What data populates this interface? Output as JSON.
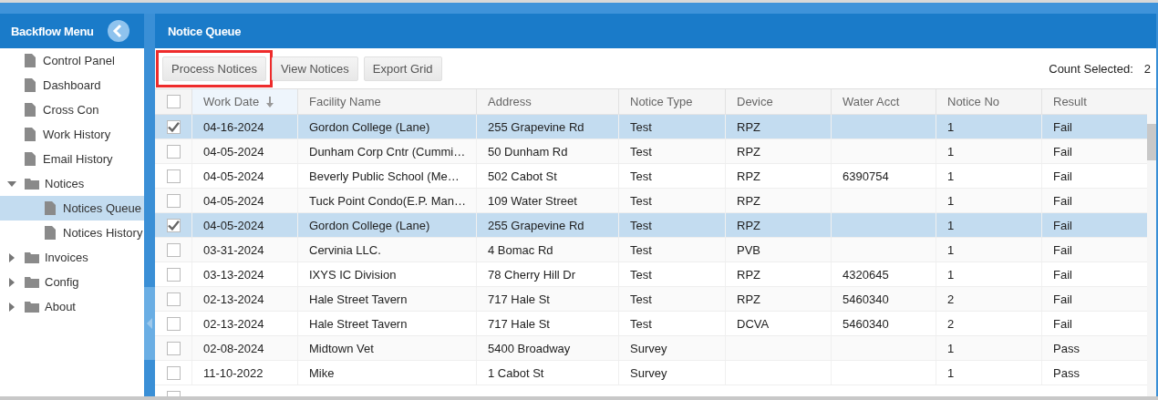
{
  "sidebar": {
    "title": "Backflow Menu",
    "items": [
      {
        "label": "Control Panel",
        "kind": "page",
        "selected": false
      },
      {
        "label": "Dashboard",
        "kind": "page",
        "selected": false
      },
      {
        "label": "Cross Con",
        "kind": "page",
        "selected": false
      },
      {
        "label": "Work History",
        "kind": "page",
        "selected": false
      },
      {
        "label": "Email History",
        "kind": "page",
        "selected": false
      },
      {
        "label": "Notices",
        "kind": "folder",
        "selected": false,
        "expanded": true,
        "children": [
          {
            "label": "Notices Queue",
            "kind": "page",
            "selected": true
          },
          {
            "label": "Notices History",
            "kind": "page",
            "selected": false
          }
        ]
      },
      {
        "label": "Invoices",
        "kind": "folder",
        "selected": false,
        "expanded": false
      },
      {
        "label": "Config",
        "kind": "folder",
        "selected": false,
        "expanded": false
      },
      {
        "label": "About",
        "kind": "folder",
        "selected": false,
        "expanded": false
      }
    ]
  },
  "panel": {
    "title": "Notice Queue"
  },
  "toolbar": {
    "buttons": [
      {
        "label": "Process Notices",
        "highlighted": true
      },
      {
        "label": "View Notices",
        "highlighted": false
      },
      {
        "label": "Export Grid",
        "highlighted": false
      }
    ],
    "count_label": "Count Selected:",
    "count_value": "2"
  },
  "table": {
    "all_checked": false,
    "columns": [
      {
        "label": "Work Date",
        "sorted": true
      },
      {
        "label": "Facility Name",
        "sorted": false
      },
      {
        "label": "Address",
        "sorted": false
      },
      {
        "label": "Notice Type",
        "sorted": false
      },
      {
        "label": "Device",
        "sorted": false
      },
      {
        "label": "Water Acct",
        "sorted": false
      },
      {
        "label": "Notice No",
        "sorted": false
      },
      {
        "label": "Result",
        "sorted": false
      }
    ],
    "rows": [
      {
        "selected": true,
        "cells": [
          "04-16-2024",
          "Gordon College (Lane)",
          "255 Grapevine Rd",
          "Test",
          "RPZ",
          "",
          "1",
          "Fail"
        ]
      },
      {
        "selected": false,
        "cells": [
          "04-05-2024",
          "Dunham Corp Cntr (Cummi…",
          "50 Dunham Rd",
          "Test",
          "RPZ",
          "",
          "1",
          "Fail"
        ]
      },
      {
        "selected": false,
        "cells": [
          "04-05-2024",
          "Beverly Public School (Me…",
          "502 Cabot St",
          "Test",
          "RPZ",
          "6390754",
          "1",
          "Fail"
        ]
      },
      {
        "selected": false,
        "cells": [
          "04-05-2024",
          "Tuck Point Condo(E.P. Man…",
          "109 Water Street",
          "Test",
          "RPZ",
          "",
          "1",
          "Fail"
        ]
      },
      {
        "selected": true,
        "cells": [
          "04-05-2024",
          "Gordon College (Lane)",
          "255 Grapevine Rd",
          "Test",
          "RPZ",
          "",
          "1",
          "Fail"
        ]
      },
      {
        "selected": false,
        "cells": [
          "03-31-2024",
          "Cervinia LLC.",
          "4 Bomac Rd",
          "Test",
          "PVB",
          "",
          "1",
          "Fail"
        ]
      },
      {
        "selected": false,
        "cells": [
          "03-13-2024",
          "IXYS IC Division",
          "78 Cherry Hill Dr",
          "Test",
          "RPZ",
          "4320645",
          "1",
          "Fail"
        ]
      },
      {
        "selected": false,
        "cells": [
          "02-13-2024",
          "Hale Street Tavern",
          "717 Hale St",
          "Test",
          "RPZ",
          "5460340",
          "2",
          "Fail"
        ]
      },
      {
        "selected": false,
        "cells": [
          "02-13-2024",
          "Hale Street Tavern",
          "717 Hale St",
          "Test",
          "DCVA",
          "5460340",
          "2",
          "Fail"
        ]
      },
      {
        "selected": false,
        "cells": [
          "02-08-2024",
          "Midtown Vet",
          "5400 Broadway",
          "Survey",
          "",
          "",
          "1",
          "Pass"
        ]
      },
      {
        "selected": false,
        "cells": [
          "11-10-2022",
          "Mike",
          "1 Cabot St",
          "Survey",
          "",
          "",
          "1",
          "Pass"
        ]
      }
    ]
  }
}
